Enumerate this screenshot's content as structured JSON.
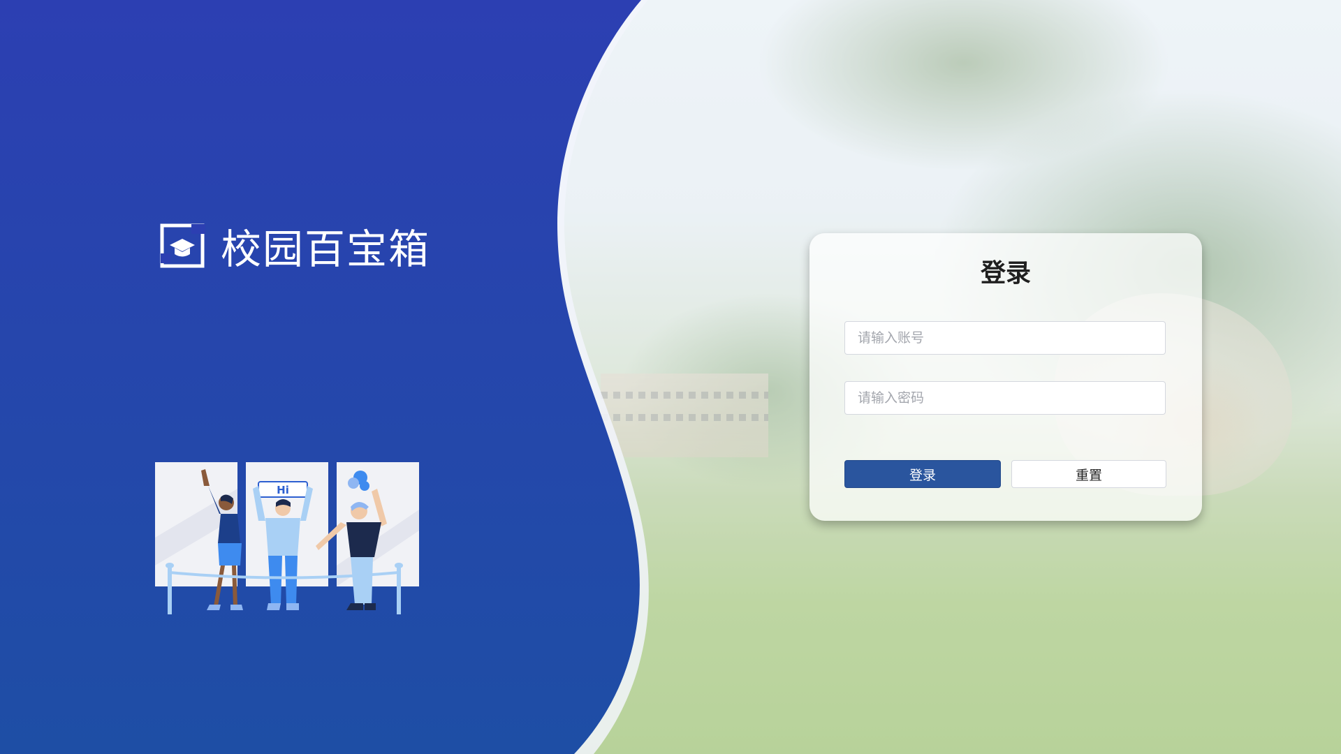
{
  "brand": {
    "name": "校园百宝箱",
    "logo_icon": "graduation-cap-icon",
    "primary_color": "#2b3fb3",
    "secondary_color": "#1e4fa6"
  },
  "illustration": {
    "sign_text": "Hi"
  },
  "login": {
    "title": "登录",
    "username_placeholder": "请输入账号",
    "password_placeholder": "请输入密码",
    "login_label": "登录",
    "reset_label": "重置",
    "button_color": "#2a559e"
  }
}
